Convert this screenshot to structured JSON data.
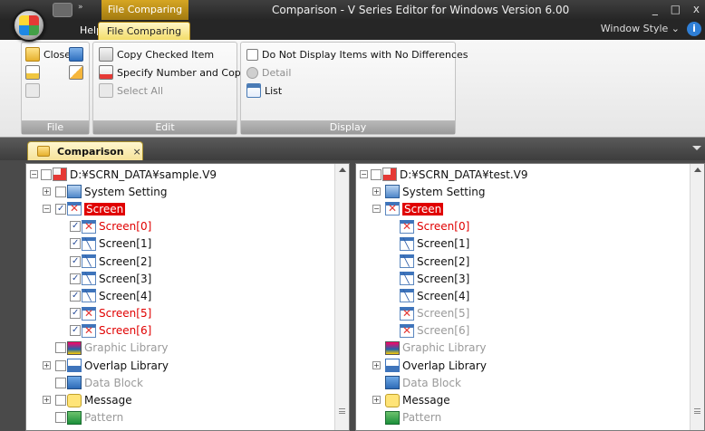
{
  "window": {
    "title": "Comparison - V Series Editor for Windows Version 6.00",
    "context_tab": "File Comparing",
    "minimize": "_",
    "maximize": "□",
    "close": "x"
  },
  "ribbon_tabs": {
    "help": "Help",
    "file_comparing": "File Comparing"
  },
  "window_style": {
    "label": "Window Style",
    "arrow": "⌄",
    "help": "i"
  },
  "ribbon": {
    "file_group": {
      "label": "File",
      "close": "Close"
    },
    "edit_group": {
      "label": "Edit",
      "copy_checked": "Copy Checked Item",
      "specify_copy": "Specify Number and Copy",
      "select_all": "Select All"
    },
    "display_group": {
      "label": "Display",
      "no_diff": "Do Not Display Items with No Differences",
      "detail": "Detail",
      "list": "List"
    }
  },
  "document_tab": {
    "label": "Comparison",
    "close": "×"
  },
  "left_tree": {
    "root": "D:¥SCRN_DATA¥sample.V9",
    "system": "System Setting",
    "screen": "Screen",
    "screens": [
      {
        "label": "Screen[0]",
        "diff": true
      },
      {
        "label": "Screen[1]",
        "diff": false
      },
      {
        "label": "Screen[2]",
        "diff": false
      },
      {
        "label": "Screen[3]",
        "diff": false
      },
      {
        "label": "Screen[4]",
        "diff": false
      },
      {
        "label": "Screen[5]",
        "diff": true
      },
      {
        "label": "Screen[6]",
        "diff": true
      }
    ],
    "graphic": "Graphic Library",
    "overlap": "Overlap Library",
    "datablock": "Data Block",
    "message": "Message",
    "pattern": "Pattern"
  },
  "right_tree": {
    "root": "D:¥SCRN_DATA¥test.V9",
    "system": "System Setting",
    "screen": "Screen",
    "screens": [
      {
        "label": "Screen[0]"
      },
      {
        "label": "Screen[1]"
      },
      {
        "label": "Screen[2]"
      },
      {
        "label": "Screen[3]"
      },
      {
        "label": "Screen[4]"
      },
      {
        "label": "Screen[5]"
      },
      {
        "label": "Screen[6]"
      }
    ],
    "graphic": "Graphic Library",
    "overlap": "Overlap Library",
    "datablock": "Data Block",
    "message": "Message",
    "pattern": "Pattern"
  }
}
